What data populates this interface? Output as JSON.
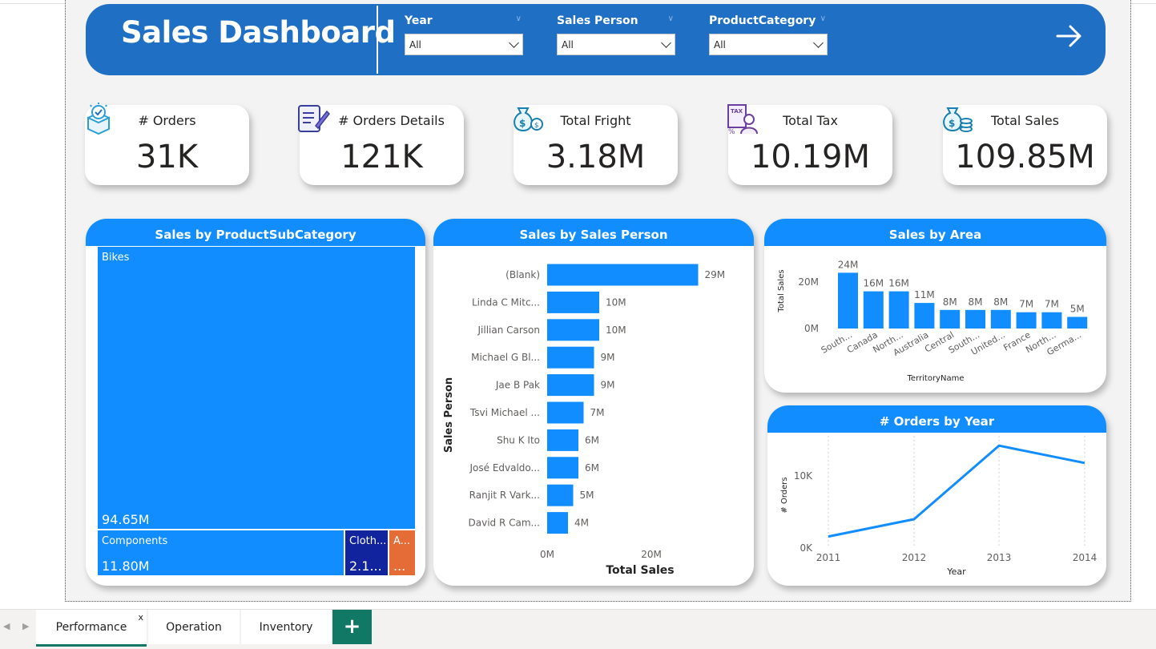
{
  "header": {
    "title": "Sales Dashboard"
  },
  "slicers": [
    {
      "label": "Year",
      "value": "All"
    },
    {
      "label": "Sales Person",
      "value": "All"
    },
    {
      "label": "ProductCategory",
      "value": "All"
    }
  ],
  "kpis": [
    {
      "label": "# Orders",
      "value": "31K",
      "icon": "order-box-icon"
    },
    {
      "label": "# Orders Details",
      "value": "121K",
      "icon": "clipboard-pen-icon"
    },
    {
      "label": "Total Fright",
      "value": "3.18M",
      "icon": "money-bag-icon"
    },
    {
      "label": "Total Tax",
      "value": "10.19M",
      "icon": "tax-person-icon"
    },
    {
      "label": "Total Sales",
      "value": "109.85M",
      "icon": "money-bag-coins-icon"
    }
  ],
  "treemap": {
    "title": "Sales by ProductSubCategory",
    "bikes": {
      "label": "Bikes",
      "value": "94.65M"
    },
    "components": {
      "label": "Components",
      "value": "11.80M"
    },
    "clothing": {
      "label": "Cloth...",
      "value": "2.1..."
    },
    "accessories": {
      "label": "A...",
      "value": "..."
    }
  },
  "salesPerson": {
    "title": "Sales by Sales Person",
    "xlabel": "Total Sales",
    "ylabel": "Sales Person",
    "ticks": [
      "0M",
      "20M"
    ]
  },
  "area": {
    "title": "Sales by Area",
    "xlabel": "TerritoryName",
    "ylabel": "Total Sales",
    "ticks": [
      "0M",
      "20M"
    ]
  },
  "ordersYear": {
    "title": "# Orders by Year",
    "xlabel": "Year",
    "ylabel": "# Orders",
    "ticks": [
      "0K",
      "10K"
    ]
  },
  "chart_data": [
    {
      "type": "treemap",
      "title": "Sales by ProductSubCategory",
      "categories": [
        "Bikes",
        "Components",
        "Clothing",
        "Accessories"
      ],
      "values": [
        94.65,
        11.8,
        2.1,
        1.3
      ],
      "unit": "M",
      "colors": [
        "#118dff",
        "#118dff",
        "#12239e",
        "#e66c37"
      ]
    },
    {
      "type": "bar",
      "orientation": "horizontal",
      "title": "Sales by Sales Person",
      "categories": [
        "(Blank)",
        "Linda C Mitc...",
        "Jillian Carson",
        "Michael G Bl...",
        "Jae B Pak",
        "Tsvi Michael ...",
        "Shu K Ito",
        "José Edvaldo...",
        "Ranjit R Vark...",
        "David R Cam..."
      ],
      "values": [
        29,
        10,
        10,
        9,
        9,
        7,
        6,
        6,
        5,
        4
      ],
      "data_labels": [
        "29M",
        "10M",
        "10M",
        "9M",
        "9M",
        "7M",
        "6M",
        "6M",
        "5M",
        "4M"
      ],
      "xlabel": "Total Sales",
      "ylabel": "Sales Person",
      "xlim": [
        0,
        30
      ]
    },
    {
      "type": "bar",
      "title": "Sales by Area",
      "categories": [
        "South...",
        "Canada",
        "North...",
        "Australia",
        "Central",
        "South...",
        "United...",
        "France",
        "North...",
        "Germa..."
      ],
      "values": [
        24,
        16,
        16,
        11,
        8,
        8,
        8,
        7,
        7,
        5
      ],
      "data_labels": [
        "24M",
        "16M",
        "16M",
        "11M",
        "8M",
        "8M",
        "8M",
        "7M",
        "7M",
        "5M"
      ],
      "xlabel": "TerritoryName",
      "ylabel": "Total Sales",
      "ylim": [
        0,
        25
      ]
    },
    {
      "type": "line",
      "title": "# Orders by Year",
      "x": [
        2011,
        2012,
        2013,
        2014
      ],
      "y": [
        1.6,
        4.0,
        14.2,
        11.8
      ],
      "unit": "K",
      "xlabel": "Year",
      "ylabel": "# Orders",
      "ylim": [
        0,
        15
      ]
    }
  ],
  "tabs": [
    {
      "label": "Performance",
      "active": true
    },
    {
      "label": "Operation",
      "active": false
    },
    {
      "label": "Inventory",
      "active": false
    }
  ],
  "colors": {
    "banner": "#1f6fc5",
    "accent": "#118dff",
    "tab_active": "#117865"
  }
}
